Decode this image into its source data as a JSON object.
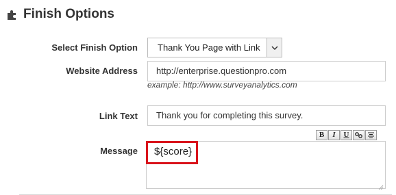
{
  "section": {
    "title": "Finish Options",
    "icon": "puzzle-piece-icon"
  },
  "fields": {
    "finish_option": {
      "label": "Select Finish Option",
      "selected": "Thank You Page with Link"
    },
    "website_address": {
      "label": "Website Address",
      "value": "http://enterprise.questionpro.com",
      "hint": "example: http://www.surveyanalytics.com"
    },
    "link_text": {
      "label": "Link Text",
      "value": "Thank you for completing this survey."
    },
    "message": {
      "label": "Message",
      "value": "${score}",
      "highlight_color": "#d9141c",
      "toolbar": {
        "bold": "B",
        "italic": "I",
        "underline": "U",
        "link_icon": "link-icon",
        "align_icon": "align-center-icon"
      }
    }
  }
}
